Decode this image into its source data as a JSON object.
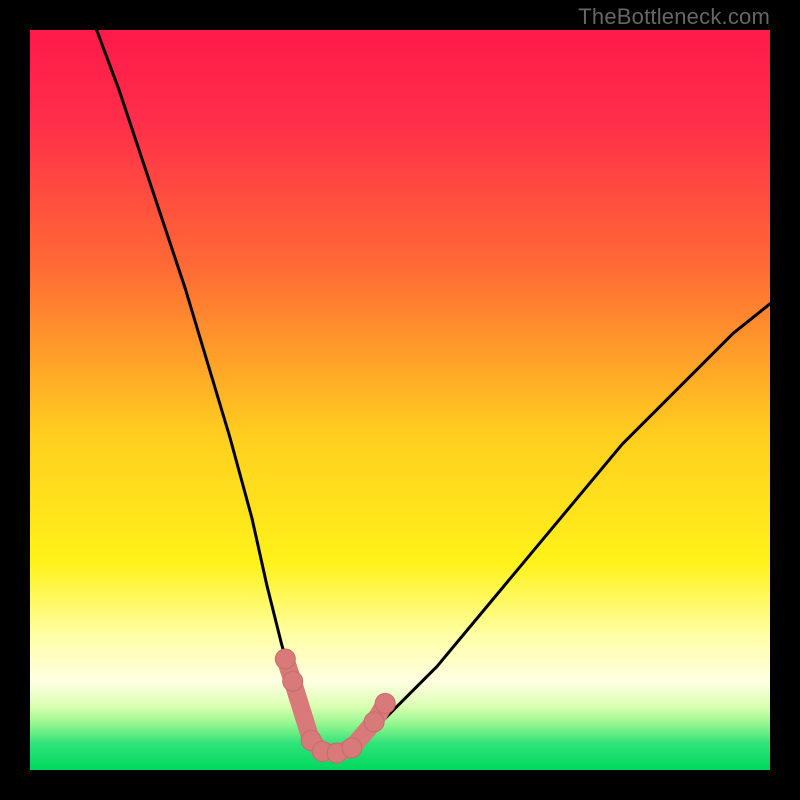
{
  "watermark": "TheBottleneck.com",
  "colors": {
    "frame": "#000000",
    "curve": "#000000",
    "mark_fill": "#d87a7a",
    "mark_stroke": "#c96a6a",
    "grad_top": "#ff1a4a",
    "grad_mid1": "#ff7a2a",
    "grad_mid2": "#ffe12a",
    "grad_pale": "#ffffa8",
    "grad_green": "#16e36b",
    "grad_bottom": "#00d85c"
  },
  "chart_data": {
    "type": "line",
    "title": "",
    "xlabel": "",
    "ylabel": "",
    "xlim": [
      0,
      100
    ],
    "ylim": [
      0,
      100
    ],
    "series": [
      {
        "name": "bottleneck-curve",
        "x": [
          9,
          12,
          15,
          18,
          21,
          24,
          27,
          30,
          32,
          34,
          36,
          37,
          38,
          39,
          40,
          42,
          44,
          46,
          50,
          55,
          60,
          65,
          70,
          75,
          80,
          85,
          90,
          95,
          100
        ],
        "y": [
          100,
          92,
          83,
          74,
          65,
          55,
          45,
          34,
          25,
          17,
          10,
          7,
          5,
          3,
          2,
          2,
          3,
          5,
          9,
          14,
          20,
          26,
          32,
          38,
          44,
          49,
          54,
          59,
          63
        ]
      }
    ],
    "markers": [
      {
        "x": 34.5,
        "y": 15
      },
      {
        "x": 35.5,
        "y": 12
      },
      {
        "x": 38,
        "y": 4
      },
      {
        "x": 39.5,
        "y": 2.5
      },
      {
        "x": 41.5,
        "y": 2.3
      },
      {
        "x": 43.5,
        "y": 3
      },
      {
        "x": 46.5,
        "y": 6.5
      },
      {
        "x": 48,
        "y": 9
      }
    ],
    "gradient_stops": [
      {
        "pos": 0.0,
        "color": "#ff1a4a"
      },
      {
        "pos": 0.12,
        "color": "#ff2d4a"
      },
      {
        "pos": 0.32,
        "color": "#ff6a35"
      },
      {
        "pos": 0.55,
        "color": "#ffcf1f"
      },
      {
        "pos": 0.72,
        "color": "#fff21a"
      },
      {
        "pos": 0.82,
        "color": "#ffffa8"
      },
      {
        "pos": 0.88,
        "color": "#ffffe3"
      },
      {
        "pos": 0.915,
        "color": "#d9ffb0"
      },
      {
        "pos": 0.94,
        "color": "#8cf58c"
      },
      {
        "pos": 0.965,
        "color": "#2de37a"
      },
      {
        "pos": 1.0,
        "color": "#00d85c"
      }
    ]
  }
}
